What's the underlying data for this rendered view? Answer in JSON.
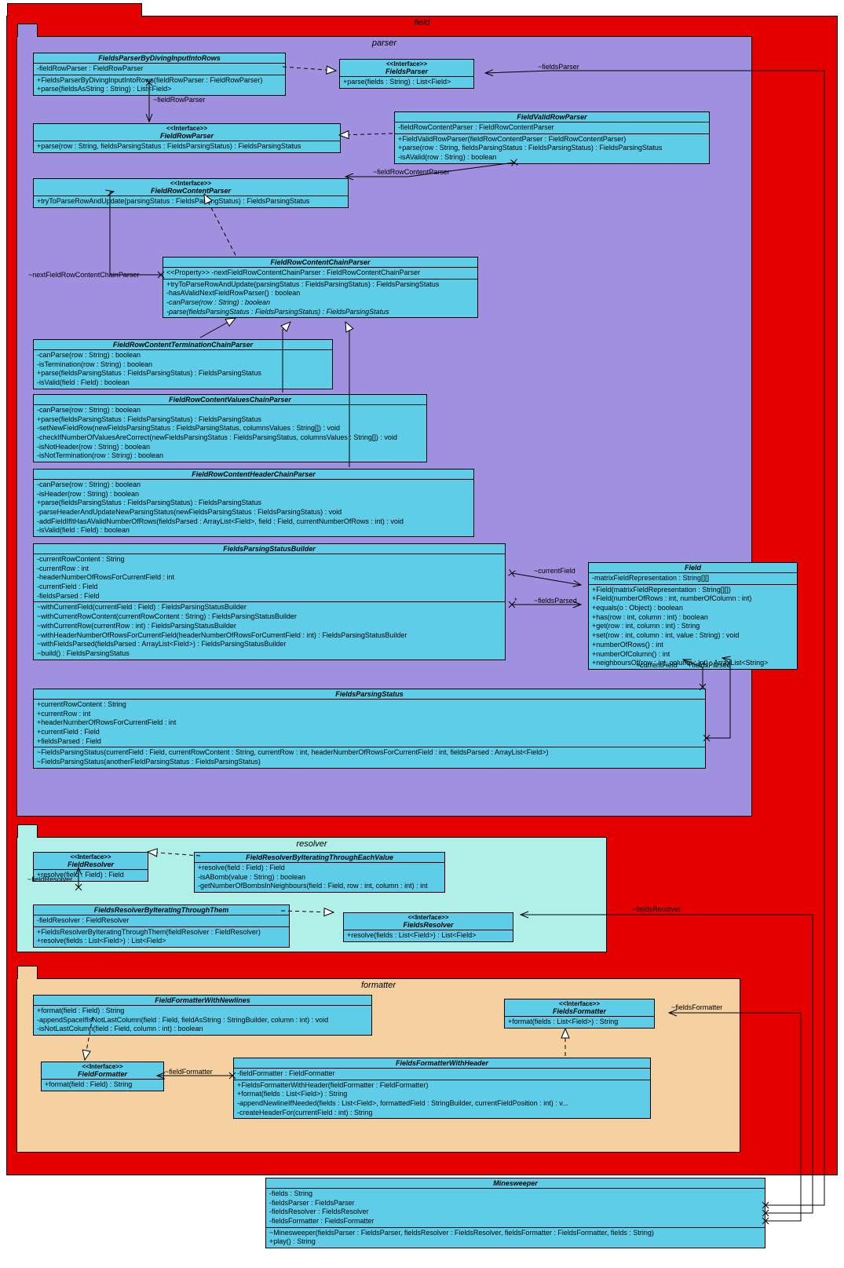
{
  "diagram_type": "UML Class Diagram",
  "packages": {
    "field": {
      "name": "field",
      "color": "#E50000",
      "tab_color": "#E50000"
    },
    "parser": {
      "name": "parser",
      "color": "#A090E0"
    },
    "resolver": {
      "name": "resolver",
      "color": "#B0F0E8"
    },
    "formatter": {
      "name": "formatter",
      "color": "#F5D0A0"
    }
  },
  "classes": {
    "FieldsParserByDivingInputIntoRows": {
      "name": "FieldsParserByDivingInputIntoRows",
      "attrs": [
        "-fieldRowParser : FieldRowParser"
      ],
      "ops": [
        "+FieldsParserByDivingInputIntoRows(fieldRowParser : FieldRowParser)",
        "+parse(fieldsAsString : String) : List<Field>"
      ]
    },
    "FieldsParser": {
      "name": "FieldsParser",
      "stereotype": "<<Interface>>",
      "ops": [
        "+parse(fields : String) : List<Field>"
      ]
    },
    "FieldRowParser": {
      "name": "FieldRowParser",
      "stereotype": "<<Interface>>",
      "ops": [
        "+parse(row : String, fieldsParsingStatus : FieldsParsingStatus) : FieldsParsingStatus"
      ]
    },
    "FieldValidRowParser": {
      "name": "FieldValidRowParser",
      "attrs": [
        "-fieldRowContentParser : FieldRowContentParser"
      ],
      "ops": [
        "+FieldValidRowParser(fieldRowContentParser : FieldRowContentParser)",
        "+parse(row : String, fieldsParsingStatus : FieldsParsingStatus) : FieldsParsingStatus",
        "-isAValid(row : String) : boolean"
      ]
    },
    "FieldRowContentParser": {
      "name": "FieldRowContentParser",
      "stereotype": "<<Interface>>",
      "ops": [
        "+tryToParseRowAndUpdate(parsingStatus : FieldsParsingStatus) : FieldsParsingStatus"
      ]
    },
    "FieldRowContentChainParser": {
      "name": "FieldRowContentChainParser",
      "attrs": [
        "<<Property>> -nextFieldRowContentChainParser : FieldRowContentChainParser"
      ],
      "ops": [
        "+tryToParseRowAndUpdate(parsingStatus : FieldsParsingStatus) : FieldsParsingStatus",
        "-hasAValidNextFieldRowParser() : boolean",
        "-canParse(row : String) : boolean",
        "-parse(fieldsParsingStatus : FieldsParsingStatus) : FieldsParsingStatus"
      ]
    },
    "FieldRowContentTerminationChainParser": {
      "name": "FieldRowContentTerminationChainParser",
      "ops": [
        "-canParse(row : String) : boolean",
        "-isTermination(row : String) : boolean",
        "+parse(fieldsParsingStatus : FieldsParsingStatus) : FieldsParsingStatus",
        "-isValid(field : Field) : boolean"
      ]
    },
    "FieldRowContentValuesChainParser": {
      "name": "FieldRowContentValuesChainParser",
      "ops": [
        "-canParse(row : String) : boolean",
        "+parse(fieldsParsingStatus : FieldsParsingStatus) : FieldsParsingStatus",
        "-setNewFieldRow(newFieldsParsingStatus : FieldsParsingStatus, columnsValues : String[]) : void",
        "-checkIfNumberOfValuesAreCorrect(newFieldsParsingStatus : FieldsParsingStatus, columnsValues : String[]) : void",
        "-isNotHeader(row : String) : boolean",
        "-isNotTermination(row : String) : boolean"
      ]
    },
    "FieldRowContentHeaderChainParser": {
      "name": "FieldRowContentHeaderChainParser",
      "ops": [
        "-canParse(row : String) : boolean",
        "-isHeader(row : String) : boolean",
        "+parse(fieldsParsingStatus : FieldsParsingStatus) : FieldsParsingStatus",
        "-parseHeaderAndUpdateNewParsingStatus(newFieldsParsingStatus : FieldsParsingStatus) : void",
        "-addFieldIfItHasAValidNumberOfRows(fieldsParsed : ArrayList<Field>, field : Field, currentNumberOfRows : int) : void",
        "-isValid(field : Field) : boolean"
      ]
    },
    "FieldsParsingStatusBuilder": {
      "name": "FieldsParsingStatusBuilder",
      "attrs": [
        "-currentRowContent : String",
        "-currentRow : int",
        "-headerNumberOfRowsForCurrentField : int",
        "-currentField : Field",
        "-fieldsParsed : Field"
      ],
      "ops": [
        "~withCurrentField(currentField : Field) : FieldsParsingStatusBuilder",
        "~withCurrentRowContent(currentRowContent : String) : FieldsParsingStatusBuilder",
        "~withCurrentRow(currentRow : int) : FieldsParsingStatusBuilder",
        "~withHeaderNumberOfRowsForCurrentField(headerNumberOfRowsForCurrentField : int) : FieldsParsingStatusBuilder",
        "~withFieldsParsed(fieldsParsed : ArrayList<Field>) : FieldsParsingStatusBuilder",
        "~build() : FieldsParsingStatus"
      ]
    },
    "FieldsParsingStatus": {
      "name": "FieldsParsingStatus",
      "attrs": [
        "+currentRowContent : String",
        "+currentRow : int",
        "+headerNumberOfRowsForCurrentField : int",
        "+currentField : Field",
        "+fieldsParsed : Field"
      ],
      "ops": [
        "~FieldsParsingStatus(currentField : Field, currentRowContent : String, currentRow : int, headerNumberOfRowsForCurrentField : int, fieldsParsed : ArrayList<Field>)",
        "~FieldsParsingStatus(anotherFieldParsingStatus : FieldsParsingStatus)"
      ]
    },
    "Field": {
      "name": "Field",
      "attrs": [
        "-matrixFieldRepresentation : String[][]"
      ],
      "ops": [
        "+Field(matrixFieldRepresentation : String[][])",
        "+Field(numberOfRows : int, numberOfColumn : int)",
        "+equals(o : Object) : boolean",
        "+has(row : int, column : int) : boolean",
        "+get(row : int, column : int) : String",
        "+set(row : int, column : int, value : String) : void",
        "+numberOfRows() : int",
        "+numberOfColumn() : int",
        "+neighboursOf(row : int, column : int) : ArrayList<String>"
      ]
    },
    "FieldResolver": {
      "name": "FieldResolver",
      "stereotype": "<<Interface>>",
      "ops": [
        "+resolve(field : Field) : Field"
      ]
    },
    "FieldResolverByIteratingThroughEachValue": {
      "name": "FieldResolverByIteratingThroughEachValue",
      "ops": [
        "+resolve(field : Field) : Field",
        "-isABomb(value : String) : boolean",
        "-getNumberOfBombsInNeighbours(field : Field, row : int, column : int) : int"
      ]
    },
    "FieldsResolverByIteratingThroughThem": {
      "name": "FieldsResolverByIteratingThroughThem",
      "attrs": [
        "-fieldResolver : FieldResolver"
      ],
      "ops": [
        "+FieldsResolverByIteratingThroughThem(fieldResolver : FieldResolver)",
        "+resolve(fields : List<Field>) : List<Field>"
      ]
    },
    "FieldsResolver": {
      "name": "FieldsResolver",
      "stereotype": "<<Interface>>",
      "ops": [
        "+resolve(fields : List<Field>) : List<Field>"
      ]
    },
    "FieldFormatterWithNewlines": {
      "name": "FieldFormatterWithNewlines",
      "ops": [
        "+format(field : Field) : String",
        "-appendSpaceIfIsNotLastColumn(field : Field, fieldAsString : StringBuilder, column : int) : void",
        "-isNotLastColumn(field : Field, column : int) : boolean"
      ]
    },
    "FieldsFormatter": {
      "name": "FieldsFormatter",
      "stereotype": "<<Interface>>",
      "ops": [
        "+format(fields : List<Field>) : String"
      ]
    },
    "FieldFormatter": {
      "name": "FieldFormatter",
      "stereotype": "<<Interface>>",
      "ops": [
        "+format(field : Field) : String"
      ]
    },
    "FieldsFormatterWithHeader": {
      "name": "FieldsFormatterWithHeader",
      "attrs": [
        "-fieldFormatter : FieldFormatter"
      ],
      "ops": [
        "+FieldsFormatterWithHeader(fieldFormatter : FieldFormatter)",
        "+format(fields : List<Field>) : String",
        "-appendNewlineIfNeeded(fields : List<Field>, formattedField : StringBuilder, currentFieldPosition : int) : v...",
        "-createHeaderFor(currentField : int) : String"
      ]
    },
    "Minesweeper": {
      "name": "Minesweeper",
      "attrs": [
        "-fields : String",
        "-fieldsParser : FieldsParser",
        "-fieldsResolver : FieldsResolver",
        "-fieldsFormatter : FieldsFormatter"
      ],
      "ops": [
        "~Minesweeper(fieldsParser : FieldsParser, fieldsResolver : FieldsResolver, fieldsFormatter : FieldsFormatter, fields : String)",
        "+play() : String"
      ]
    }
  },
  "relationships": [
    {
      "from": "FieldsParserByDivingInputIntoRows",
      "to": "FieldsParser",
      "type": "realization"
    },
    {
      "from": "FieldValidRowParser",
      "to": "FieldRowParser",
      "type": "realization"
    },
    {
      "from": "FieldRowContentChainParser",
      "to": "FieldRowContentParser",
      "type": "realization"
    },
    {
      "from": "FieldRowContentTerminationChainParser",
      "to": "FieldRowContentChainParser",
      "type": "generalization"
    },
    {
      "from": "FieldRowContentValuesChainParser",
      "to": "FieldRowContentChainParser",
      "type": "generalization"
    },
    {
      "from": "FieldRowContentHeaderChainParser",
      "to": "FieldRowContentChainParser",
      "type": "generalization"
    },
    {
      "from": "FieldResolverByIteratingThroughEachValue",
      "to": "FieldResolver",
      "type": "realization"
    },
    {
      "from": "FieldsResolverByIteratingThroughThem",
      "to": "FieldsResolver",
      "type": "realization"
    },
    {
      "from": "FieldFormatterWithNewlines",
      "to": "FieldFormatter",
      "type": "realization"
    },
    {
      "from": "FieldsFormatterWithHeader",
      "to": "FieldsFormatter",
      "type": "realization"
    }
  ],
  "associations": [
    {
      "label": "~fieldsParser",
      "from": "Minesweeper",
      "to": "FieldsParser"
    },
    {
      "label": "~fieldRowParser",
      "from": "FieldsParserByDivingInputIntoRows",
      "to": "FieldRowParser"
    },
    {
      "label": "~fieldRowContentParser",
      "from": "FieldValidRowParser",
      "to": "FieldRowContentParser"
    },
    {
      "label": "~nextFieldRowContentChainParser",
      "from": "FieldRowContentChainParser",
      "to": "FieldRowContentChainParser"
    },
    {
      "label": "~currentField",
      "from": "FieldsParsingStatusBuilder",
      "to": "Field"
    },
    {
      "label": "~fieldsParsed",
      "from": "FieldsParsingStatusBuilder",
      "to": "Field",
      "multiplicity": "*"
    },
    {
      "label": "+currentField",
      "from": "FieldsParsingStatus",
      "to": "Field"
    },
    {
      "label": "+fieldsParsed",
      "from": "FieldsParsingStatus",
      "to": "Field",
      "multiplicity": "*"
    },
    {
      "label": "~fieldResolver",
      "from": "FieldsResolverByIteratingThroughThem",
      "to": "FieldResolver"
    },
    {
      "label": "~fieldsResolver",
      "from": "Minesweeper",
      "to": "FieldsResolver"
    },
    {
      "label": "~fieldFormatter",
      "from": "FieldsFormatterWithHeader",
      "to": "FieldFormatter"
    },
    {
      "label": "~fieldsFormatter",
      "from": "Minesweeper",
      "to": "FieldsFormatter"
    }
  ]
}
